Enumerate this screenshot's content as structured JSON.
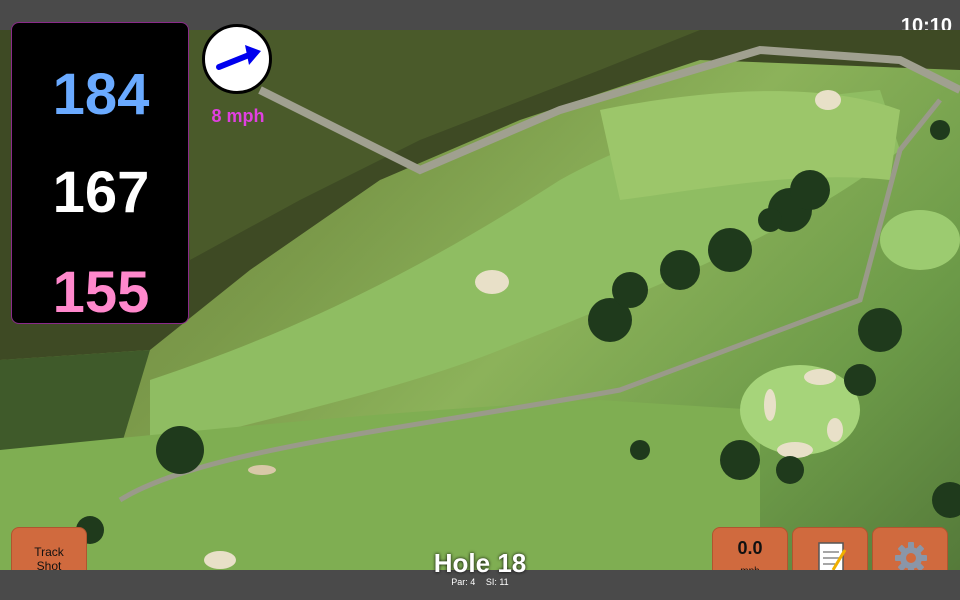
{
  "status_bar": {
    "time": "10:10"
  },
  "distances": {
    "back": "184",
    "middle": "167",
    "front": "155"
  },
  "wind": {
    "speed": "8 mph",
    "icon": "arrow-icon"
  },
  "buttons": {
    "track_shot": "Track\nShot",
    "speed_value": "0.0",
    "speed_unit": "mph",
    "notes_icon": "notes-icon",
    "settings_icon": "gear-icon"
  },
  "hole": {
    "title": "Hole 18",
    "par": "Par: 4",
    "si": "SI: 11"
  }
}
